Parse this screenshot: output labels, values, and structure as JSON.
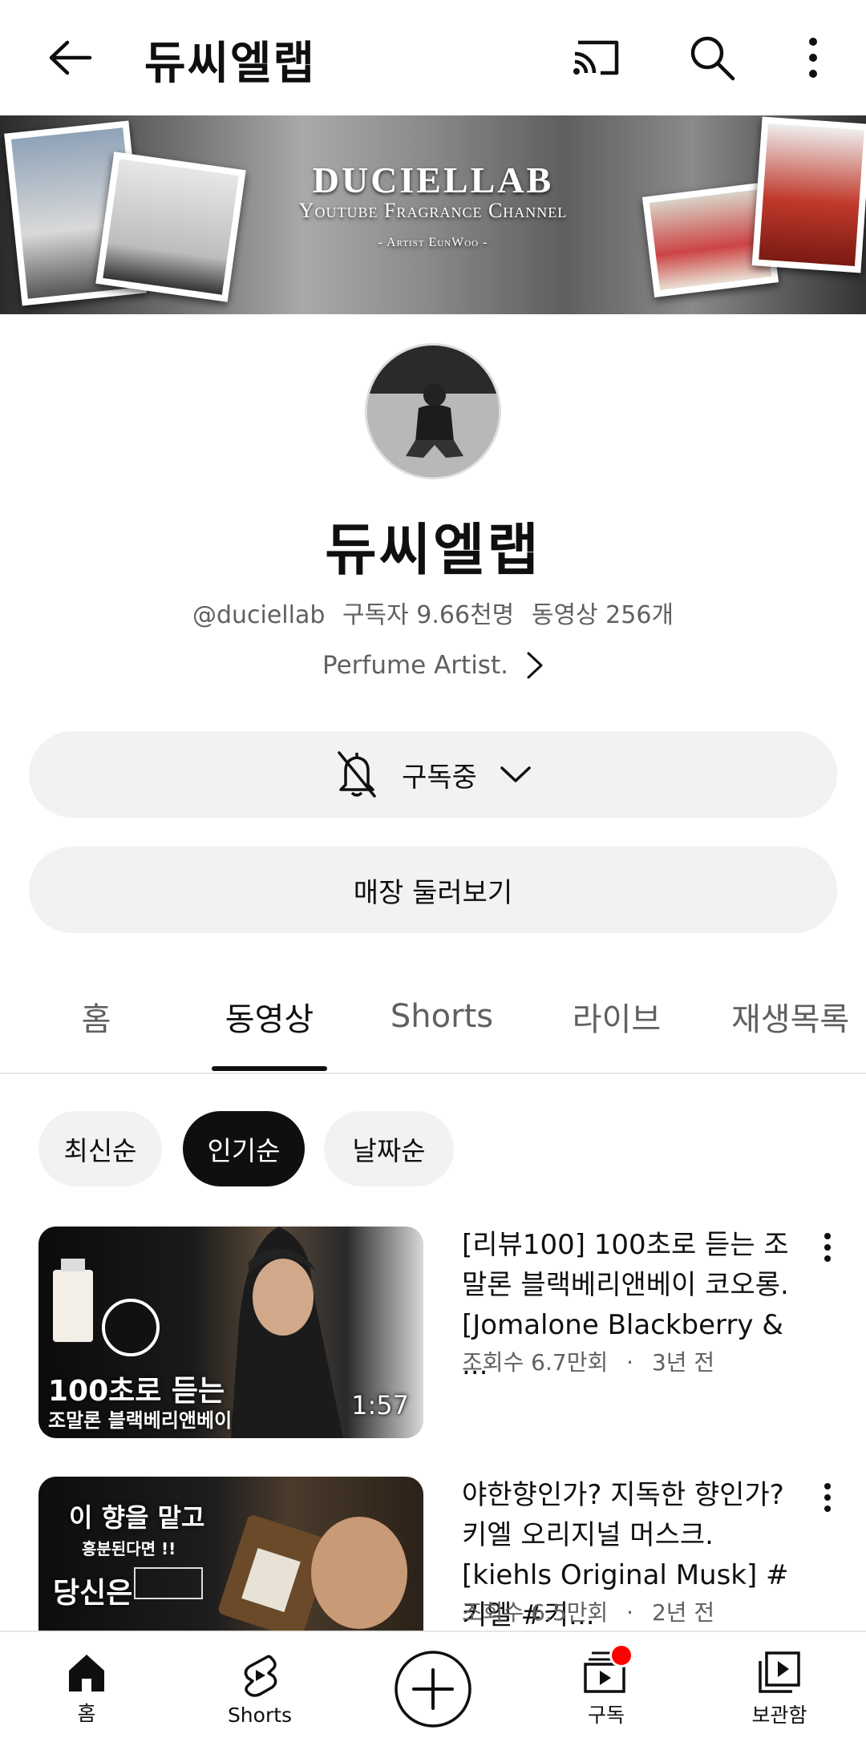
{
  "header": {
    "title": "듀씨엘랩"
  },
  "banner": {
    "brand": "DUCIELLAB",
    "subtitle": "Youtube Fragrance Channel",
    "artist": "- Artist EunWoo -"
  },
  "channel": {
    "name": "듀씨엘랩",
    "handle": "@duciellab",
    "subscribers": "구독자 9.66천명",
    "video_count": "동영상 256개",
    "description": "Perfume Artist."
  },
  "buttons": {
    "subscribed": "구독중",
    "store": "매장 둘러보기"
  },
  "tabs": [
    {
      "label": "홈",
      "active": false
    },
    {
      "label": "동영상",
      "active": true
    },
    {
      "label": "Shorts",
      "active": false
    },
    {
      "label": "라이브",
      "active": false
    },
    {
      "label": "재생목록",
      "active": false
    }
  ],
  "chips": [
    {
      "label": "최신순",
      "active": false
    },
    {
      "label": "인기순",
      "active": true
    },
    {
      "label": "날짜순",
      "active": false
    }
  ],
  "videos": [
    {
      "title": "[리뷰100] 100초로 듣는 조말론 블랙베리앤베이 코오롱. [Jomalone Blackberry & ...",
      "views": "조회수 6.7만회",
      "age": "3년 전",
      "duration": "1:57",
      "thumb_text_1": "100초로 듣는",
      "thumb_text_2": "조말론 블랙베리앤베이"
    },
    {
      "title": "야한향인가? 지독한 향인가? 키엘 오리지널 머스크.[kiehls Original Musk] #키엘 #키...",
      "views": "조회수 6.5만회",
      "age": "2년 전",
      "thumb_text_1": "이 향을 맡고",
      "thumb_text_2": "흥분된다면 !!",
      "thumb_text_3": "당신은"
    }
  ],
  "bottom_nav": [
    {
      "label": "홈",
      "icon": "home-icon"
    },
    {
      "label": "Shorts",
      "icon": "shorts-icon"
    },
    {
      "label": "",
      "icon": "create-icon"
    },
    {
      "label": "구독",
      "icon": "subscriptions-icon"
    },
    {
      "label": "보관함",
      "icon": "library-icon"
    }
  ],
  "colors": {
    "notification_dot": "#ff0000",
    "active_chip": "#0f0f0f"
  }
}
